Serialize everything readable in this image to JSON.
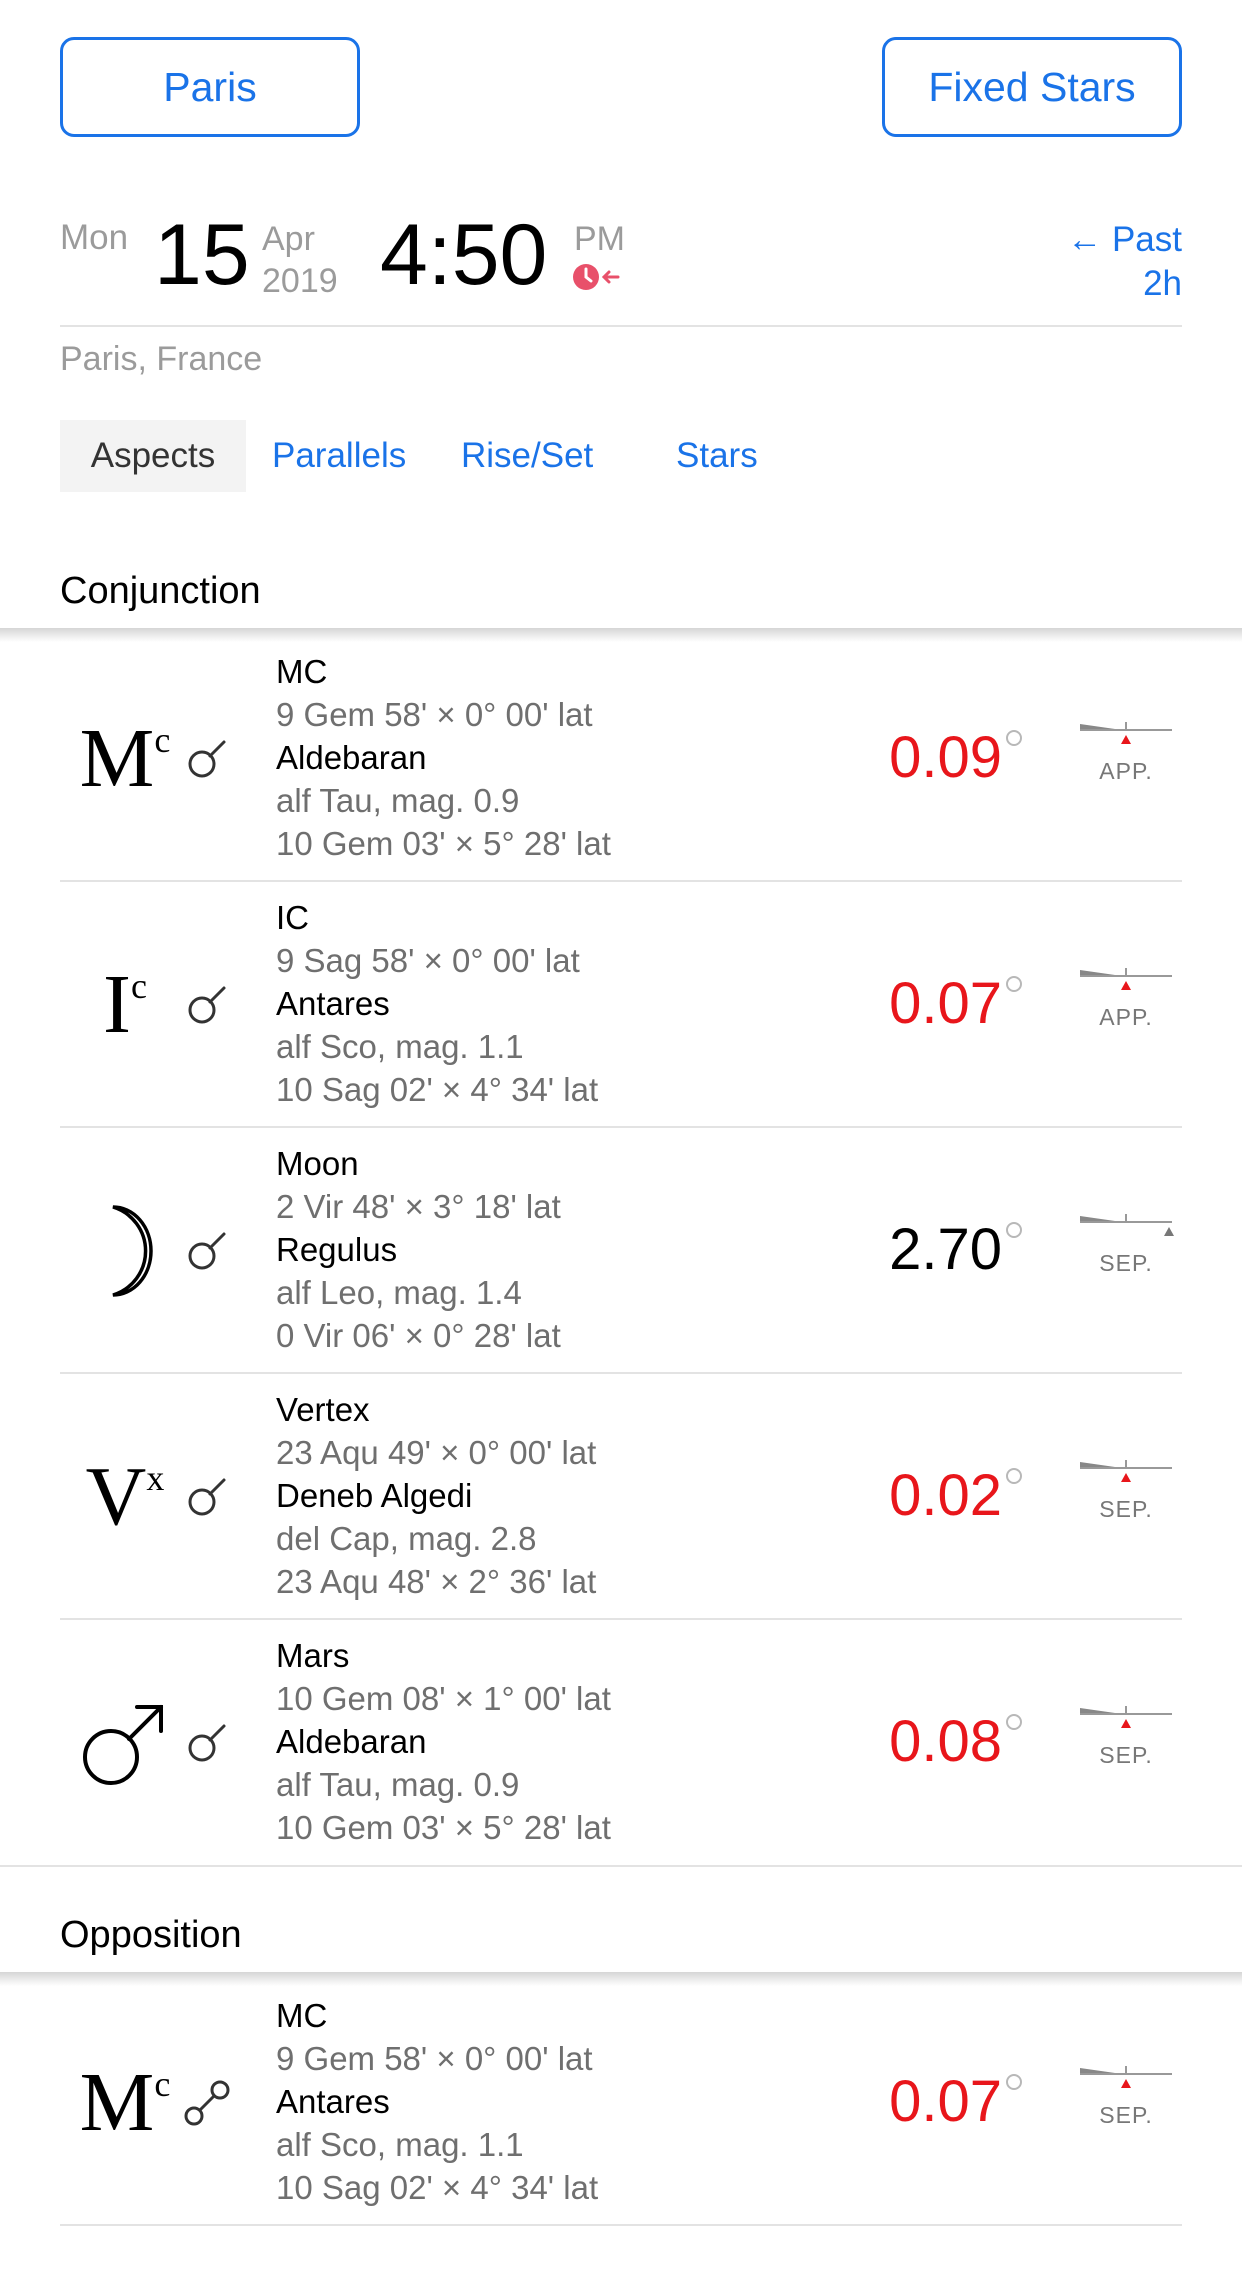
{
  "header": {
    "location_button": "Paris",
    "mode_button": "Fixed Stars",
    "weekday": "Mon",
    "day": "15",
    "month": "Apr",
    "year": "2019",
    "time": "4:50",
    "ampm": "PM",
    "past_label": "← Past",
    "past_amount": "2h",
    "place": "Paris, France"
  },
  "tabs": [
    "Aspects",
    "Parallels",
    "Rise/Set",
    "Stars"
  ],
  "active_tab": "Aspects",
  "colors": {
    "accent": "#1a73e8",
    "applying": "#e8161b",
    "separator": "#e3e3e3"
  },
  "sections": [
    {
      "title": "Conjunction",
      "rows": [
        {
          "glyph": "Mc",
          "aspect_icon": "conjunction-icon",
          "body": "MC",
          "body_pos": "9 Gem 58' × 0° 00' lat",
          "star": "Aldebaran",
          "star_info": "alf Tau, mag. 0.9",
          "star_pos": "10 Gem 03' × 5° 28' lat",
          "orb": "0.09",
          "highlight": true,
          "status": "APP."
        },
        {
          "glyph": "Ic",
          "aspect_icon": "conjunction-icon",
          "body": "IC",
          "body_pos": "9 Sag 58' × 0° 00' lat",
          "star": "Antares",
          "star_info": "alf Sco, mag. 1.1",
          "star_pos": "10 Sag 02' × 4° 34' lat",
          "orb": "0.07",
          "highlight": true,
          "status": "APP."
        },
        {
          "glyph": "moon",
          "aspect_icon": "conjunction-icon",
          "body": "Moon",
          "body_pos": "2 Vir 48' × 3° 18' lat",
          "star": "Regulus",
          "star_info": "alf Leo, mag. 1.4",
          "star_pos": "0 Vir 06' × 0° 28' lat",
          "orb": "2.70",
          "highlight": false,
          "status": "SEP."
        },
        {
          "glyph": "Vx",
          "aspect_icon": "conjunction-icon",
          "body": "Vertex",
          "body_pos": "23 Aqu 49' × 0° 00' lat",
          "star": "Deneb Algedi",
          "star_info": "del Cap, mag. 2.8",
          "star_pos": "23 Aqu 48' × 2° 36' lat",
          "orb": "0.02",
          "highlight": true,
          "status": "SEP."
        },
        {
          "glyph": "mars",
          "aspect_icon": "conjunction-icon",
          "body": "Mars",
          "body_pos": "10 Gem 08' × 1° 00' lat",
          "star": "Aldebaran",
          "star_info": "alf Tau, mag. 0.9",
          "star_pos": "10 Gem 03' × 5° 28' lat",
          "orb": "0.08",
          "highlight": true,
          "status": "SEP."
        }
      ]
    },
    {
      "title": "Opposition",
      "rows": [
        {
          "glyph": "Mc",
          "aspect_icon": "opposition-icon",
          "body": "MC",
          "body_pos": "9 Gem 58' × 0° 00' lat",
          "star": "Antares",
          "star_info": "alf Sco, mag. 1.1",
          "star_pos": "10 Sag 02' × 4° 34' lat",
          "orb": "0.07",
          "highlight": true,
          "status": "SEP."
        }
      ]
    }
  ]
}
